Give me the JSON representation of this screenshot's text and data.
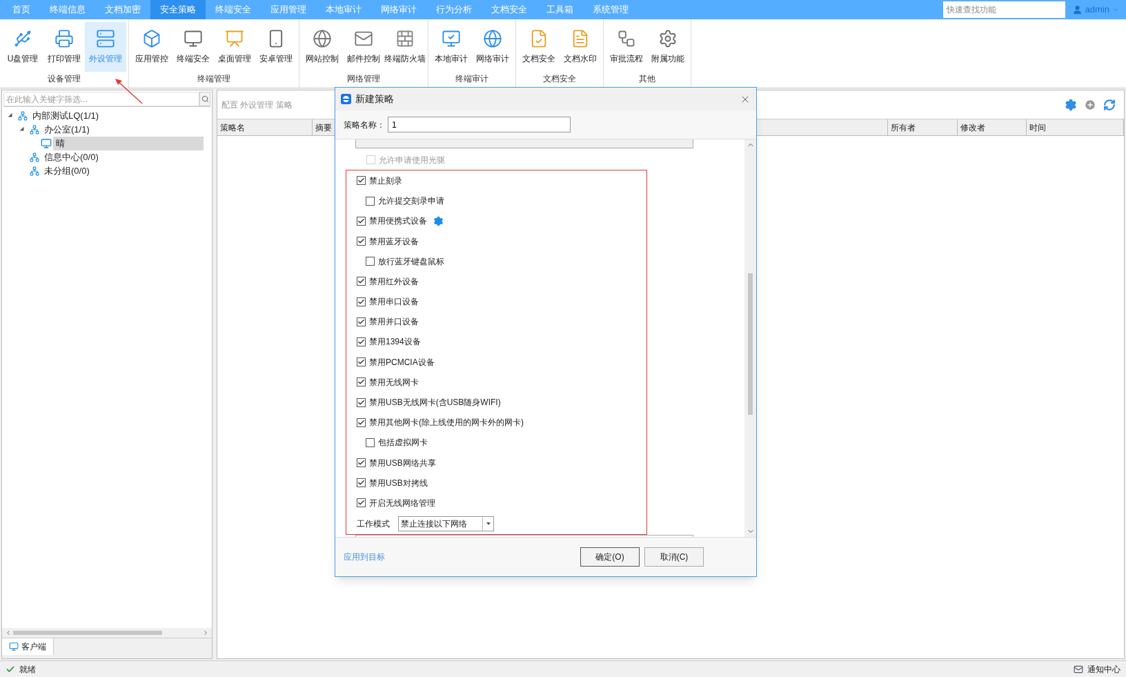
{
  "top_nav": {
    "tabs": [
      {
        "label": "首页",
        "selected": false
      },
      {
        "label": "终端信息",
        "selected": false
      },
      {
        "label": "文档加密",
        "selected": false
      },
      {
        "label": "安全策略",
        "selected": true
      },
      {
        "label": "终端安全",
        "selected": false
      },
      {
        "label": "应用管理",
        "selected": false
      },
      {
        "label": "本地审计",
        "selected": false
      },
      {
        "label": "网络审计",
        "selected": false
      },
      {
        "label": "行为分析",
        "selected": false
      },
      {
        "label": "文档安全",
        "selected": false
      },
      {
        "label": "工具箱",
        "selected": false
      },
      {
        "label": "系统管理",
        "selected": false
      }
    ],
    "search": {
      "placeholder": "快速查找功能"
    },
    "user": "admin"
  },
  "ribbon": {
    "groups": [
      {
        "label": "设备管理",
        "items": [
          {
            "label": "U盘管理",
            "selected": false
          },
          {
            "label": "打印管理",
            "selected": false
          },
          {
            "label": "外设管理",
            "selected": true
          }
        ]
      },
      {
        "label": "终端管理",
        "items": [
          {
            "label": "应用管控",
            "selected": false
          },
          {
            "label": "终端安全",
            "selected": false
          },
          {
            "label": "桌面管理",
            "selected": false
          },
          {
            "label": "安卓管理",
            "selected": false
          }
        ]
      },
      {
        "label": "网络管理",
        "items": [
          {
            "label": "网站控制",
            "selected": false
          },
          {
            "label": "邮件控制",
            "selected": false
          },
          {
            "label": "终端防火墙",
            "selected": false
          }
        ]
      },
      {
        "label": "终端审计",
        "items": [
          {
            "label": "本地审计",
            "selected": false
          },
          {
            "label": "网络审计",
            "selected": false
          }
        ]
      },
      {
        "label": "文档安全",
        "items": [
          {
            "label": "文档安全",
            "selected": false
          },
          {
            "label": "文档水印",
            "selected": false
          }
        ]
      },
      {
        "label": "其他",
        "items": [
          {
            "label": "审批流程",
            "selected": false
          },
          {
            "label": "附属功能",
            "selected": false
          }
        ]
      }
    ]
  },
  "left_panel": {
    "filter": {
      "placeholder": "在此输入关键字筛选..."
    },
    "tree": [
      {
        "label": "内部测试LQ(1/1)",
        "kind": "group",
        "expanded": true,
        "selected": false,
        "children": [
          {
            "label": "办公室(1/1)",
            "kind": "group",
            "expanded": true,
            "selected": false,
            "children": [
              {
                "label": "晴",
                "kind": "computer",
                "selected": true
              }
            ]
          },
          {
            "label": "信息中心(0/0)",
            "kind": "group",
            "selected": false
          },
          {
            "label": "未分组(0/0)",
            "kind": "group",
            "selected": false
          }
        ]
      }
    ],
    "bottom_tab": "客户端"
  },
  "right_panel": {
    "breadcrumb": "配置 外设管理 策略",
    "table": {
      "columns": [
        "策略名",
        "摘要",
        "所有者",
        "修改者",
        "时间"
      ]
    }
  },
  "dialog": {
    "title": "新建策略",
    "name_label": "策略名称：",
    "name_value": "1",
    "options": [
      {
        "label": "允许申请使用光驱",
        "kind": "sub",
        "checked": false,
        "disabled": true,
        "has_settings": false
      },
      {
        "label": "禁止刻录",
        "kind": "main",
        "checked": true,
        "disabled": false,
        "has_settings": false
      },
      {
        "label": "允许提交刻录申请",
        "kind": "sub",
        "checked": false,
        "disabled": false,
        "has_settings": false
      },
      {
        "label": "禁用便携式设备",
        "kind": "main",
        "checked": true,
        "disabled": false,
        "has_settings": true
      },
      {
        "label": "禁用蓝牙设备",
        "kind": "main",
        "checked": true,
        "disabled": false,
        "has_settings": false
      },
      {
        "label": "放行蓝牙键盘鼠标",
        "kind": "sub",
        "checked": false,
        "disabled": false,
        "has_settings": false
      },
      {
        "label": "禁用红外设备",
        "kind": "main",
        "checked": true,
        "disabled": false,
        "has_settings": false
      },
      {
        "label": "禁用串口设备",
        "kind": "main",
        "checked": true,
        "disabled": false,
        "has_settings": false
      },
      {
        "label": "禁用并口设备",
        "kind": "main",
        "checked": true,
        "disabled": false,
        "has_settings": false
      },
      {
        "label": "禁用1394设备",
        "kind": "main",
        "checked": true,
        "disabled": false,
        "has_settings": false
      },
      {
        "label": "禁用PCMCIA设备",
        "kind": "main",
        "checked": true,
        "disabled": false,
        "has_settings": false
      },
      {
        "label": "禁用无线网卡",
        "kind": "main",
        "checked": true,
        "disabled": false,
        "has_settings": false
      },
      {
        "label": "禁用USB无线网卡(含USB随身WIFI)",
        "kind": "main",
        "checked": true,
        "disabled": false,
        "has_settings": false
      },
      {
        "label": "禁用其他网卡(除上线使用的网卡外的网卡)",
        "kind": "main",
        "checked": true,
        "disabled": false,
        "has_settings": false
      },
      {
        "label": "包括虚拟网卡",
        "kind": "sub",
        "checked": false,
        "disabled": false,
        "has_settings": false
      },
      {
        "label": "禁用USB网络共享",
        "kind": "main",
        "checked": true,
        "disabled": false,
        "has_settings": false
      },
      {
        "label": "禁用USB对拷线",
        "kind": "main",
        "checked": true,
        "disabled": false,
        "has_settings": false
      },
      {
        "label": "开启无线网络管理",
        "kind": "main",
        "checked": true,
        "disabled": false,
        "has_settings": false
      }
    ],
    "work_mode": {
      "label": "工作模式",
      "value": "禁止连接以下网络"
    },
    "apply_link": "应用到目标",
    "buttons": [
      "确定(O)",
      "取消(C)"
    ]
  },
  "status_bar": {
    "text": "就绪",
    "notifications": "通知中心"
  }
}
